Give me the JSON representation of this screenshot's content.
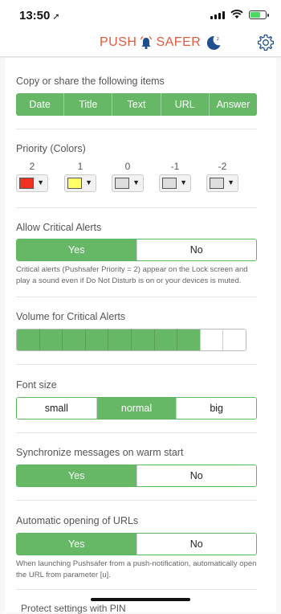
{
  "status": {
    "time": "13:50",
    "location_glyph": "➚"
  },
  "header": {
    "logo_left": "PUSH",
    "logo_right": "SAFER",
    "brand_color": "#e05a3c",
    "icon_color": "#1f4f8f"
  },
  "copy": {
    "label": "Copy or share the following items",
    "items": [
      "Date",
      "Title",
      "Text",
      "URL",
      "Answer"
    ]
  },
  "priority": {
    "label": "Priority (Colors)",
    "levels": [
      {
        "num": "2",
        "color": "#ee3322"
      },
      {
        "num": "1",
        "color": "#ffff66"
      },
      {
        "num": "0",
        "color": "#dddddd"
      },
      {
        "num": "-1",
        "color": "#dddddd"
      },
      {
        "num": "-2",
        "color": "#dddddd"
      }
    ]
  },
  "critical": {
    "label": "Allow Critical Alerts",
    "yes": "Yes",
    "no": "No",
    "selected": "Yes",
    "note": "Critical alerts (Pushsafer Priority = 2) appear on the Lock screen and play a sound even if Do Not Disturb is on or your devices is muted."
  },
  "volume": {
    "label": "Volume for Critical Alerts",
    "level": 8,
    "max": 10
  },
  "fontsize": {
    "label": "Font size",
    "options": [
      "small",
      "normal",
      "big"
    ],
    "selected": "normal"
  },
  "sync": {
    "label": "Synchronize messages on warm start",
    "yes": "Yes",
    "no": "No",
    "selected": "Yes"
  },
  "autourl": {
    "label": "Automatic opening of URLs",
    "yes": "Yes",
    "no": "No",
    "selected": "Yes",
    "note": "When launching Pushsafer from a push-notification, automatically open the URL from parameter [u]."
  },
  "cutoff_label": "Protect settings with PIN"
}
